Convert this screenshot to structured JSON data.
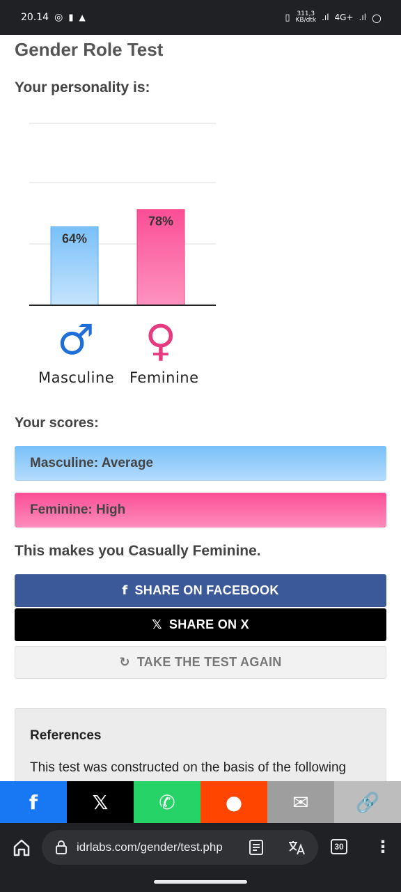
{
  "status_bar": {
    "time": "20.14",
    "speed_value": "311,3",
    "speed_unit": "KB/dtk",
    "network": "4G+"
  },
  "page": {
    "title": "Gender Role Test",
    "subtitle": "Your personality is:"
  },
  "chart_data": {
    "type": "bar",
    "categories": [
      "Masculine",
      "Feminine"
    ],
    "values": [
      64,
      78
    ],
    "data_labels": [
      "64%",
      "78%"
    ],
    "ylim": [
      0,
      100
    ],
    "grid": true,
    "colors": [
      "#79c0f8",
      "#fb4e96"
    ]
  },
  "symbols": {
    "masculine_glyph": "♂",
    "feminine_glyph": "♀",
    "masculine_label": "Masculine",
    "feminine_label": "Feminine"
  },
  "scores": {
    "heading": "Your scores:",
    "masculine": "Masculine: Average",
    "feminine": "Feminine: High"
  },
  "verdict": "This makes you Casually Feminine.",
  "buttons": {
    "facebook": "SHARE ON FACEBOOK",
    "x": "SHARE ON X",
    "again": "TAKE THE TEST AGAIN",
    "facebook_icon": "f",
    "x_icon": "𝕏",
    "again_icon": "↻"
  },
  "references": {
    "title": "References",
    "text": "This test was constructed on the basis of the following"
  },
  "share_bar": [
    {
      "icon": "facebook-icon",
      "glyph": "f",
      "color": "#1877f2"
    },
    {
      "icon": "x-icon",
      "glyph": "𝕏",
      "color": "#000000"
    },
    {
      "icon": "whatsapp-icon",
      "glyph": "✆",
      "color": "#25d366"
    },
    {
      "icon": "reddit-icon",
      "glyph": "●",
      "color": "#ff4500"
    },
    {
      "icon": "email-icon",
      "glyph": "✉",
      "color": "#9e9e9e"
    },
    {
      "icon": "link-icon",
      "glyph": "🔗",
      "color": "#bdbdbd"
    }
  ],
  "browser": {
    "url": "idrlabs.com/gender/test.php",
    "tab_count": "30",
    "menu_glyph": "⋮"
  }
}
